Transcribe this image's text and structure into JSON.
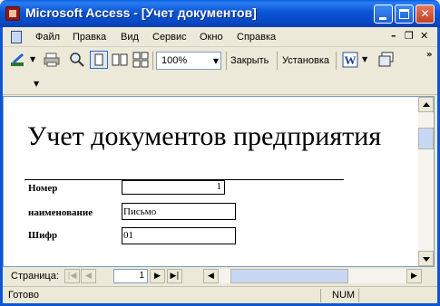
{
  "window": {
    "title": "Microsoft Access - [Учет документов]"
  },
  "menu": {
    "items": [
      "Файл",
      "Правка",
      "Вид",
      "Сервис",
      "Окно",
      "Справка"
    ]
  },
  "toolbar": {
    "zoom": "100%",
    "close_label": "Закрыть",
    "setup_label": "Установка"
  },
  "report": {
    "title": "Учет документов предприятия",
    "fields": [
      {
        "label": "Номер",
        "value": "1"
      },
      {
        "label": "наименование",
        "value": "Письмо"
      },
      {
        "label": "Шифр",
        "value": "01"
      }
    ]
  },
  "navigation": {
    "label": "Страница:",
    "page": "1"
  },
  "status": {
    "text": "Готово",
    "num": "NUM"
  },
  "colors": {
    "titlebar": "#0b55d6",
    "chrome": "#ece9d8"
  }
}
